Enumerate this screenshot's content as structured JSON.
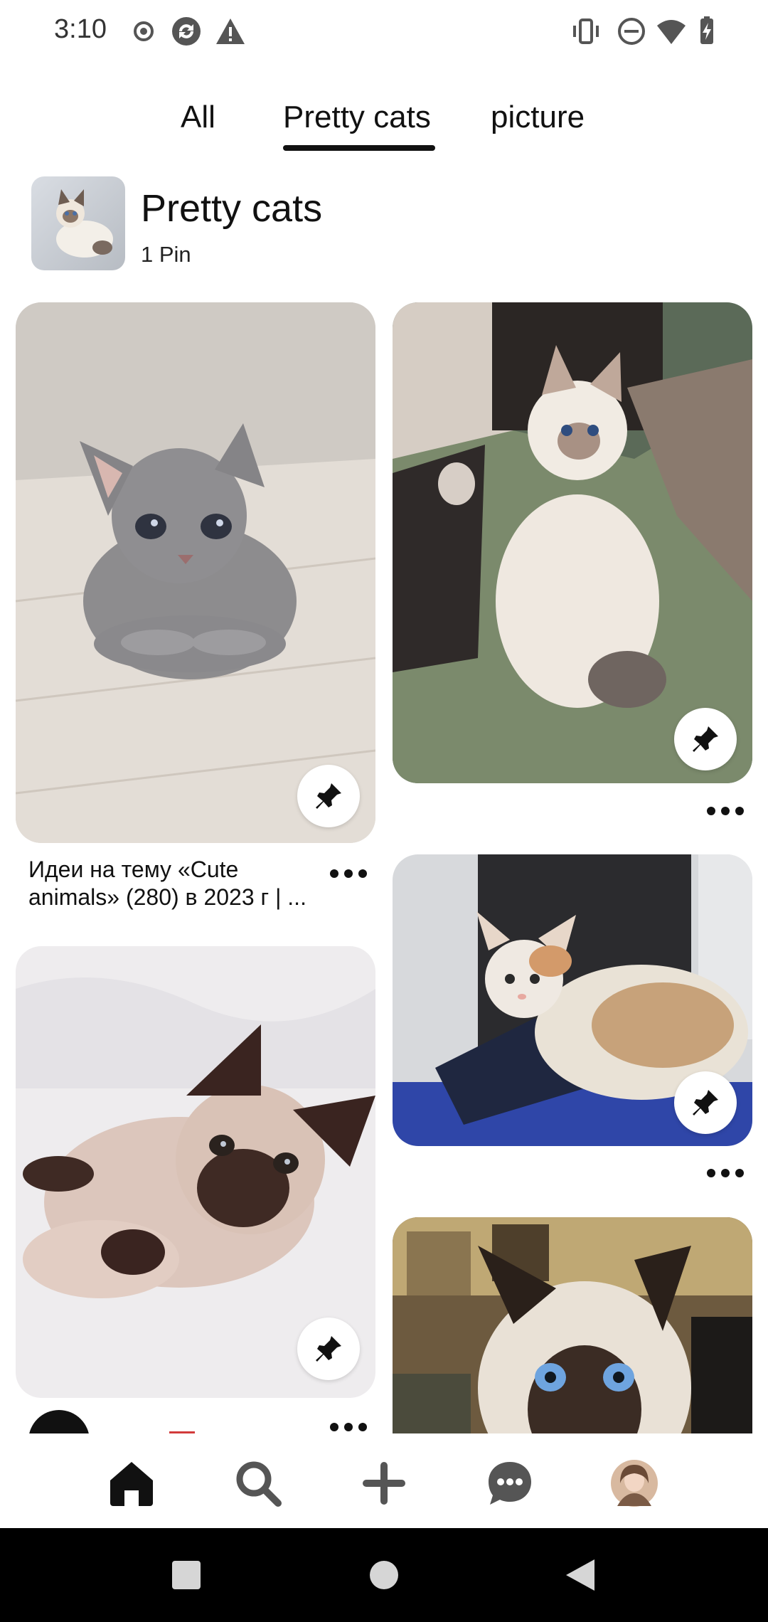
{
  "status_bar": {
    "time": "3:10",
    "left_icons": [
      "record-icon",
      "sync-icon",
      "warning-icon"
    ],
    "right_icons": [
      "vibrate-icon",
      "do-not-disturb-icon",
      "wifi-icon",
      "battery-charging-icon"
    ]
  },
  "tabs": [
    {
      "label": "All",
      "selected": false
    },
    {
      "label": "Pretty cats",
      "selected": true
    },
    {
      "label": "picture",
      "selected": false
    }
  ],
  "board": {
    "title": "Pretty cats",
    "pin_count": "1 Pin"
  },
  "pins": [
    {
      "id": "grey-kitten",
      "caption": "Идеи на тему «Cute animals» (280) в 2023 г | ...",
      "save_icon": "pin-icon",
      "more_icon": "more-icon"
    },
    {
      "id": "fluffy-kitten",
      "caption": "",
      "save_icon": "pin-icon",
      "more_icon": "more-icon"
    },
    {
      "id": "calico-kitten",
      "caption": "",
      "save_icon": "pin-icon",
      "more_icon": "more-icon"
    },
    {
      "id": "siamese-kitten",
      "caption": "",
      "save_icon": "pin-icon",
      "more_icon": "more-icon"
    },
    {
      "id": "siamese-cat",
      "caption": "",
      "save_icon": "pin-icon",
      "more_icon": "more-icon"
    }
  ],
  "bottom_nav": [
    {
      "name": "home",
      "icon": "home-icon",
      "active": true
    },
    {
      "name": "search",
      "icon": "search-icon",
      "active": false
    },
    {
      "name": "create",
      "icon": "plus-icon",
      "active": false
    },
    {
      "name": "messages",
      "icon": "chat-icon",
      "active": false
    },
    {
      "name": "profile",
      "icon": "avatar",
      "active": false
    }
  ],
  "system_nav": [
    "recents-icon",
    "home-circle-icon",
    "back-icon"
  ],
  "colors": {
    "text": "#111111",
    "background": "#ffffff",
    "nav_bar": "#000000",
    "icon_grey": "#555555"
  }
}
